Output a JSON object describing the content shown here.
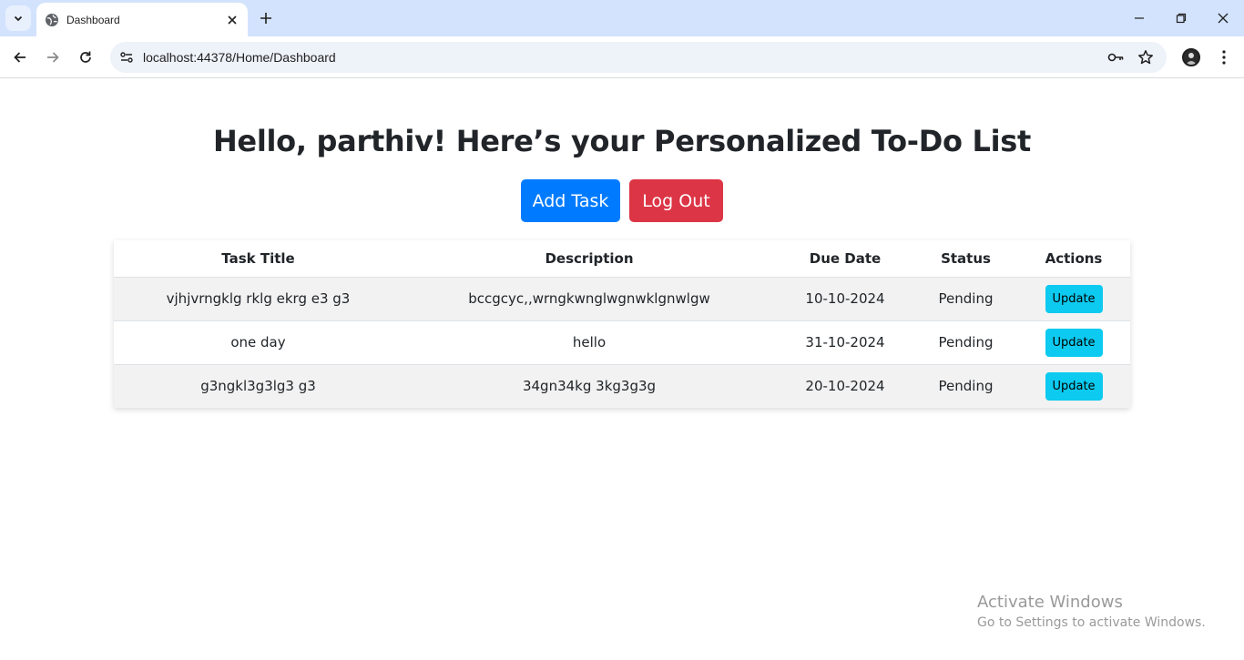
{
  "browser": {
    "tab_title": "Dashboard",
    "url": "localhost:44378/Home/Dashboard"
  },
  "page": {
    "heading": "Hello, parthiv! Here’s your Personalized To-Do List",
    "add_task_label": "Add Task",
    "logout_label": "Log Out"
  },
  "table": {
    "headers": [
      "Task Title",
      "Description",
      "Due Date",
      "Status",
      "Actions"
    ],
    "rows": [
      {
        "title": "vjhjvrngklg rklg ekrg e3 g3",
        "description": "bccgcyc,,wrngkwnglwgnwklgnwlgw",
        "due_date": "10-10-2024",
        "status": "Pending",
        "action": "Update"
      },
      {
        "title": "one day",
        "description": "hello",
        "due_date": "31-10-2024",
        "status": "Pending",
        "action": "Update"
      },
      {
        "title": "g3ngkl3g3lg3 g3",
        "description": "34gn34kg 3kg3g3g",
        "due_date": "20-10-2024",
        "status": "Pending",
        "action": "Update"
      }
    ]
  },
  "watermark": {
    "title": "Activate Windows",
    "subtitle": "Go to Settings to activate Windows."
  },
  "colors": {
    "primary": "#007bff",
    "danger": "#dc3545",
    "info": "#0dcaf0",
    "tabbar": "#d3e3fd"
  }
}
